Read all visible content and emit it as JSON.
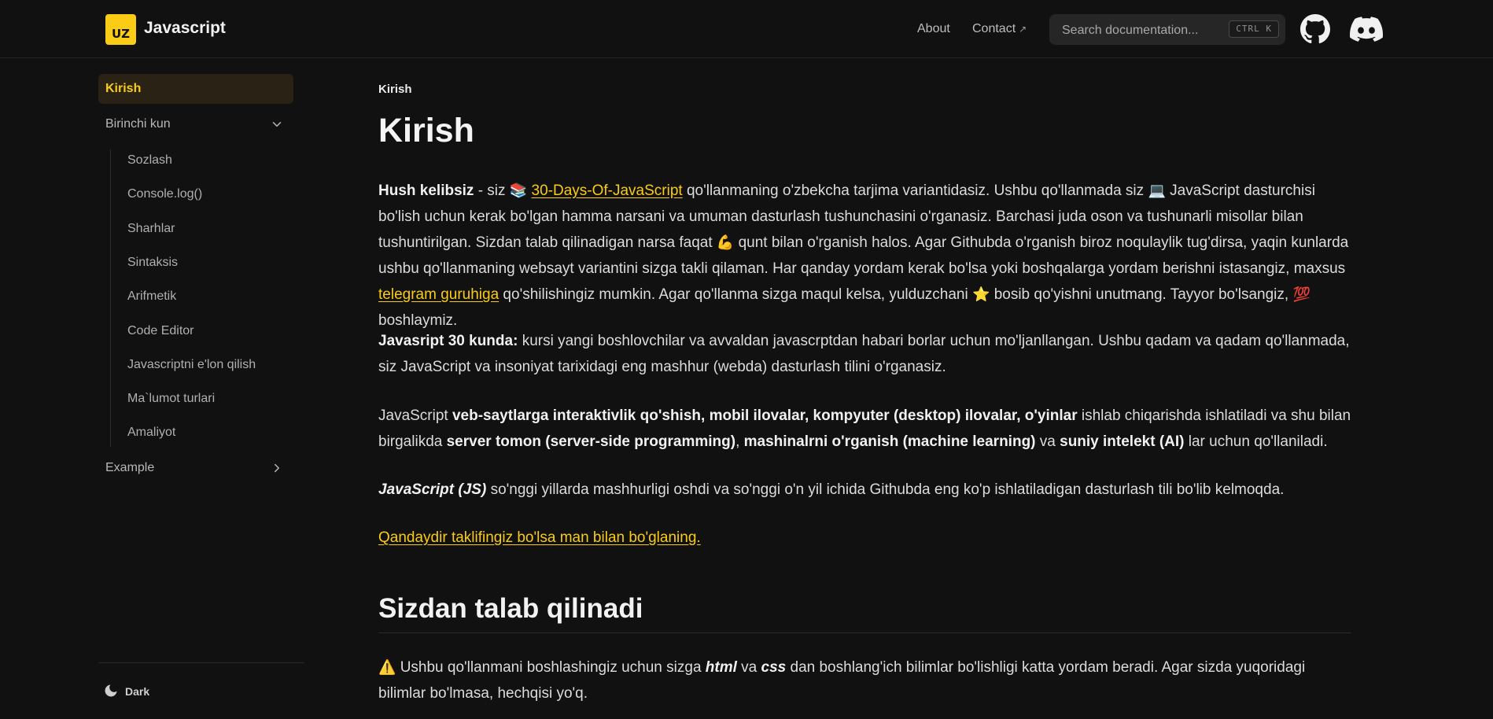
{
  "header": {
    "logo_text": "UZ",
    "brand": "Javascript",
    "nav": [
      {
        "label": "About"
      },
      {
        "label": "Contact",
        "external_icon": "↗"
      }
    ],
    "search": {
      "placeholder": "Search documentation...",
      "shortcut": "CTRL K"
    },
    "github_icon": "github-icon",
    "discord_icon": "discord-icon"
  },
  "sidebar": {
    "items": [
      {
        "label": "Kirish",
        "active": true
      },
      {
        "label": "Birinchi kun",
        "expanded": true
      },
      {
        "label": "Example",
        "expanded": false
      }
    ],
    "sub_items": [
      "Sozlash",
      "Console.log()",
      "Sharhlar",
      "Sintaksis",
      "Arifmetik",
      "Code Editor",
      "Javascriptni e'lon qilish",
      "Ma`lumot turlari",
      "Amaliyot"
    ],
    "theme_label": "Dark"
  },
  "main": {
    "breadcrumb": "Kirish",
    "title": "Kirish",
    "p1": {
      "bold": "Hush kelibsiz",
      "t1": " - siz ",
      "emoji1": "📚",
      "link1": "30-Days-Of-JavaScript",
      "t2": " qo'llanmaning o'zbekcha tarjima variantidasiz. Ushbu qo'llanmada siz ",
      "emoji2": "💻",
      "t3": " JavaScript dasturchisi bo'lish uchun kerak bo'lgan hamma narsani va umuman dasturlash tushunchasini o'rganasiz. Barchasi juda oson va tushunarli misollar bilan tushuntirilgan. Sizdan talab qilinadigan narsa faqat ",
      "emoji3": "💪",
      "t4": " qunt bilan o'rganish halos. Agar Githubda o'rganish biroz noqulaylik tug'dirsa, yaqin kunlarda ushbu qo'llanmaning websayt variantini sizga takli qilaman. Har qanday yordam kerak bo'lsa yoki boshqalarga yordam berishni istasangiz, maxsus ",
      "link2": "telegram guruhiga",
      "t5": " qo'shilishingiz mumkin. Agar qo'llanma sizga maqul kelsa, yulduzchani ",
      "emoji4": "⭐",
      "t6": " bosib qo'yishni unutmang. Tayyor bo'lsangiz, ",
      "emoji5": "💯",
      "t7": " boshlaymiz."
    },
    "p2": {
      "bold": "Javasript 30 kunda:",
      "text": " kursi yangi boshlovchilar va avvaldan javascrptdan habari borlar uchun mo'ljanllangan. Ushbu qadam va qadam qo'llanmada, siz JavaScript va insoniyat tarixidagi eng mashhur (webda) dasturlash tilini o'rganasiz."
    },
    "p3": {
      "t1": "JavaScript ",
      "b1": "veb-saytlarga interaktivlik qo'shish, mobil ilovalar, kompyuter (desktop) ilovalar, o'yinlar",
      "t2": " ishlab chiqarishda ishlatiladi va shu bilan birgalikda ",
      "b2": "server tomon (server-side programming)",
      "t3": ", ",
      "b3": "mashinalrni o'rganish (machine learning)",
      "t4": " va ",
      "b4": "suniy intelekt (AI)",
      "t5": " lar uchun qo'llaniladi."
    },
    "p4": {
      "bi": "JavaScript (JS)",
      "text": " so'nggi yillarda mashhurligi oshdi va so'nggi o'n yil ichida Githubda eng ko'p ishlatiladigan dasturlash tili bo'lib kelmoqda."
    },
    "p5_link": "Qandaydir taklifingiz bo'lsa man bilan bo'glaning.",
    "h2": "Sizdan talab qilinadi",
    "p6": {
      "emoji": "⚠️",
      "t1": " Ushbu qo'llanmani boshlashingiz uchun sizga ",
      "bi1": "html",
      "t2": " va ",
      "bi2": "css",
      "t3": " dan boshlang'ich bilimlar bo'lishligi katta yordam beradi. Agar sizda yuqoridagi bilimlar bo'lmasa, hechqisi yo'q."
    }
  },
  "colors": {
    "accent": "#facc15",
    "background": "#111111",
    "text": "#dcdcdc"
  }
}
